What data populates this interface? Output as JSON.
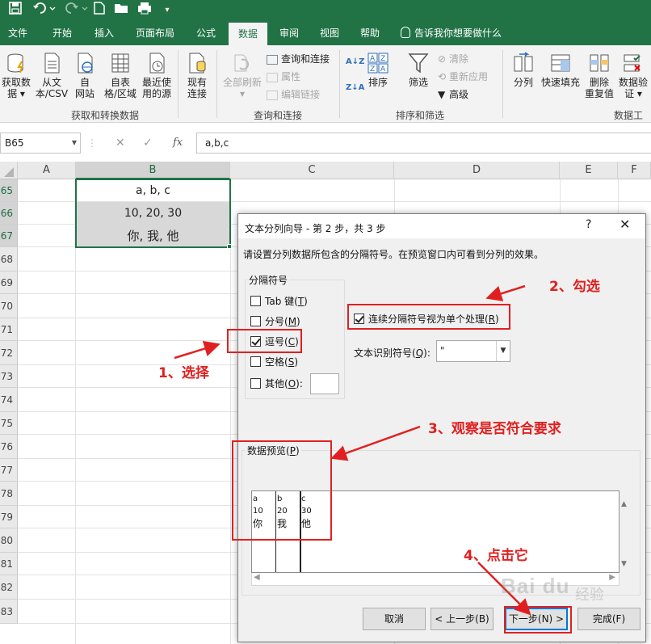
{
  "quick_access": {
    "save_icon": "save-icon",
    "undo_icon": "undo-icon",
    "redo_icon": "redo-icon",
    "new_icon": "new-file-icon",
    "open_icon": "open-folder-icon",
    "customize_icon": "customize-icon"
  },
  "ribbon_tabs": [
    "文件",
    "开始",
    "插入",
    "页面布局",
    "公式",
    "数据",
    "审阅",
    "视图",
    "帮助"
  ],
  "active_tab": "数据",
  "tell_me": "告诉我你想要做什么",
  "ribbon": {
    "get_data": {
      "line1": "获取数",
      "line2": "据 ▾"
    },
    "from_csv": {
      "line1": "从文",
      "line2": "本/CSV"
    },
    "from_web": {
      "line1": "自",
      "line2": "网站"
    },
    "from_table": {
      "line1": "自表",
      "line2": "格/区域"
    },
    "recent_sources": {
      "line1": "最近使",
      "line2": "用的源"
    },
    "existing_conn": {
      "line1": "现有",
      "line2": "连接"
    },
    "refresh_all": {
      "line1": "全部刷新",
      "line2": "▾"
    },
    "queries_conn": "查询和连接",
    "properties": "属性",
    "edit_links": "编辑链接",
    "sort": "排序",
    "filter": "筛选",
    "clear": "清除",
    "reapply": "重新应用",
    "advanced": "高级",
    "split": "分列",
    "flash_fill": "快速填充",
    "remove_dup": {
      "line1": "删除",
      "line2": "重复值"
    },
    "data_validate": {
      "line1": "数据验",
      "line2": "证 ▾"
    },
    "groups": {
      "get_transform": "获取和转换数据",
      "queries": "查询和连接",
      "sort_filter": "排序和筛选",
      "data_tools": "数据工具"
    }
  },
  "name_box": "B65",
  "formula": "a,b,c",
  "formula_icons": {
    "cancel": "✕",
    "enter": "✓",
    "fx": "fx"
  },
  "columns": [
    "A",
    "B",
    "C",
    "D",
    "E",
    "F"
  ],
  "rows": [
    "65",
    "66",
    "67",
    "68",
    "69",
    "70",
    "71",
    "72",
    "73",
    "74",
    "75",
    "76",
    "77",
    "78",
    "79",
    "80",
    "81",
    "82",
    "83"
  ],
  "cells": {
    "b65": "a, b, c",
    "b66": "10, 20, 30",
    "b67": "你, 我, 他"
  },
  "dialog": {
    "title": "文本分列向导 - 第 2 步，共 3 步",
    "help": "?",
    "close": "✕",
    "description": "请设置分列数据所包含的分隔符号。在预览窗口内可看到分列的效果。",
    "delimiters_title": "分隔符号",
    "tab": {
      "text": "Tab 键(",
      "key": "T",
      "end": ")",
      "checked": false
    },
    "semicolon": {
      "text": "分号(",
      "key": "M",
      "end": ")",
      "checked": false
    },
    "comma": {
      "text": "逗号(",
      "key": "C",
      "end": ")",
      "checked": true
    },
    "space": {
      "text": "空格(",
      "key": "S",
      "end": ")",
      "checked": false
    },
    "other": {
      "text": "其他(",
      "key": "O",
      "end": "):",
      "checked": false
    },
    "consecutive": {
      "text": "连续分隔符号视为单个处理(",
      "key": "R",
      "end": ")",
      "checked": true
    },
    "qualifier_label": {
      "text": "文本识别符号(",
      "key": "Q",
      "end": "):"
    },
    "qualifier_value": "\"",
    "preview_title": {
      "text": "数据预览(",
      "key": "P",
      "end": ")"
    },
    "preview": [
      [
        "a",
        "b",
        "c"
      ],
      [
        "10",
        "20",
        "30"
      ],
      [
        "你",
        "我",
        "他"
      ]
    ],
    "buttons": {
      "cancel": "取消",
      "back": "< 上一步(B)",
      "next": "下一步(N) >",
      "finish": "完成(F)"
    }
  },
  "annotations": {
    "step1": "1、选择",
    "step2": "2、勾选",
    "step3": "3、观察是否符合要求",
    "step4": "4、点击它",
    "color": "#e02020"
  },
  "watermark": {
    "main": "Bai du",
    "sub": "经验"
  }
}
